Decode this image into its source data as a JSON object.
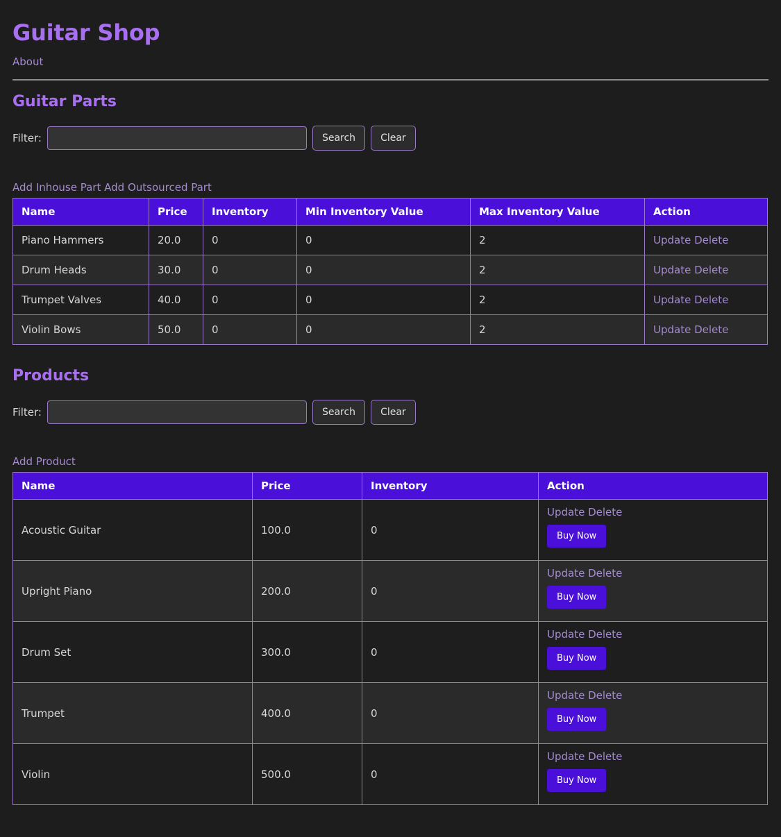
{
  "header": {
    "title": "Guitar Shop",
    "nav": [
      {
        "label": "About"
      }
    ]
  },
  "parts_section": {
    "title": "Guitar Parts",
    "filter": {
      "label": "Filter:",
      "value": "",
      "placeholder": "",
      "search_label": "Search",
      "clear_label": "Clear"
    },
    "links": [
      {
        "label": "Add Inhouse Part"
      },
      {
        "label": "Add Outsourced Part"
      }
    ],
    "columns": [
      "Name",
      "Price",
      "Inventory",
      "Min Inventory Value",
      "Max Inventory Value",
      "Action"
    ],
    "action_links": {
      "update": "Update",
      "delete": "Delete"
    },
    "rows": [
      {
        "name": "Piano Hammers",
        "price": "20.0",
        "inventory": "0",
        "min_inventory": "0",
        "max_inventory": "2"
      },
      {
        "name": "Drum Heads",
        "price": "30.0",
        "inventory": "0",
        "min_inventory": "0",
        "max_inventory": "2"
      },
      {
        "name": "Trumpet Valves",
        "price": "40.0",
        "inventory": "0",
        "min_inventory": "0",
        "max_inventory": "2"
      },
      {
        "name": "Violin Bows",
        "price": "50.0",
        "inventory": "0",
        "min_inventory": "0",
        "max_inventory": "2"
      }
    ]
  },
  "products_section": {
    "title": "Products",
    "filter": {
      "label": "Filter:",
      "value": "",
      "placeholder": "",
      "search_label": "Search",
      "clear_label": "Clear"
    },
    "links": [
      {
        "label": "Add Product"
      }
    ],
    "columns": [
      "Name",
      "Price",
      "Inventory",
      "Action"
    ],
    "action_links": {
      "update": "Update",
      "delete": "Delete",
      "buy": "Buy Now"
    },
    "rows": [
      {
        "name": "Acoustic Guitar",
        "price": "100.0",
        "inventory": "0"
      },
      {
        "name": "Upright Piano",
        "price": "200.0",
        "inventory": "0"
      },
      {
        "name": "Drum Set",
        "price": "300.0",
        "inventory": "0"
      },
      {
        "name": "Trumpet",
        "price": "400.0",
        "inventory": "0"
      },
      {
        "name": "Violin",
        "price": "500.0",
        "inventory": "0"
      }
    ]
  },
  "colors": {
    "background": "#1d1d1d",
    "accent_heading": "#a86ff0",
    "table_header": "#4a0fd9",
    "link": "#a58bd0",
    "border": "#9b79c9"
  }
}
